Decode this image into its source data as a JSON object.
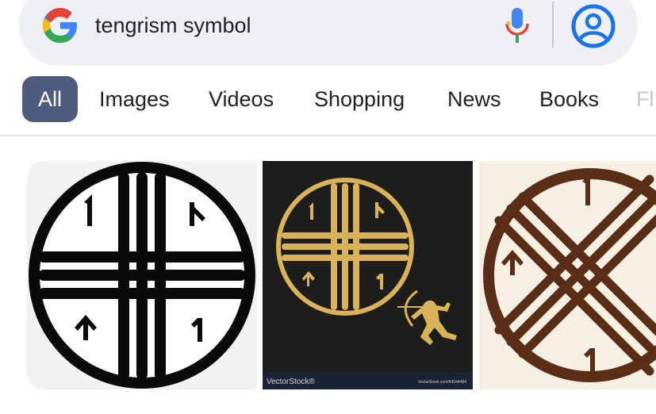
{
  "search": {
    "query": "tengrism symbol",
    "logo_icon": "google-g-icon",
    "mic_icon": "microphone-icon",
    "account_icon": "account-circle-icon"
  },
  "tabs": [
    {
      "label": "All",
      "active": true
    },
    {
      "label": "Images"
    },
    {
      "label": "Videos"
    },
    {
      "label": "Shopping"
    },
    {
      "label": "News"
    },
    {
      "label": "Books"
    },
    {
      "label": "Fl"
    }
  ],
  "results": {
    "image2_watermark": "VectorStock®",
    "image2_watermark_url": "VectorStock.com/43544484"
  },
  "colors": {
    "accent_tab": "#4f5b7d",
    "search_bg": "#eef0f3",
    "account_blue": "#1a73e8",
    "symbol_gold": "#d9b25a",
    "symbol_brown": "#5a2d16"
  }
}
